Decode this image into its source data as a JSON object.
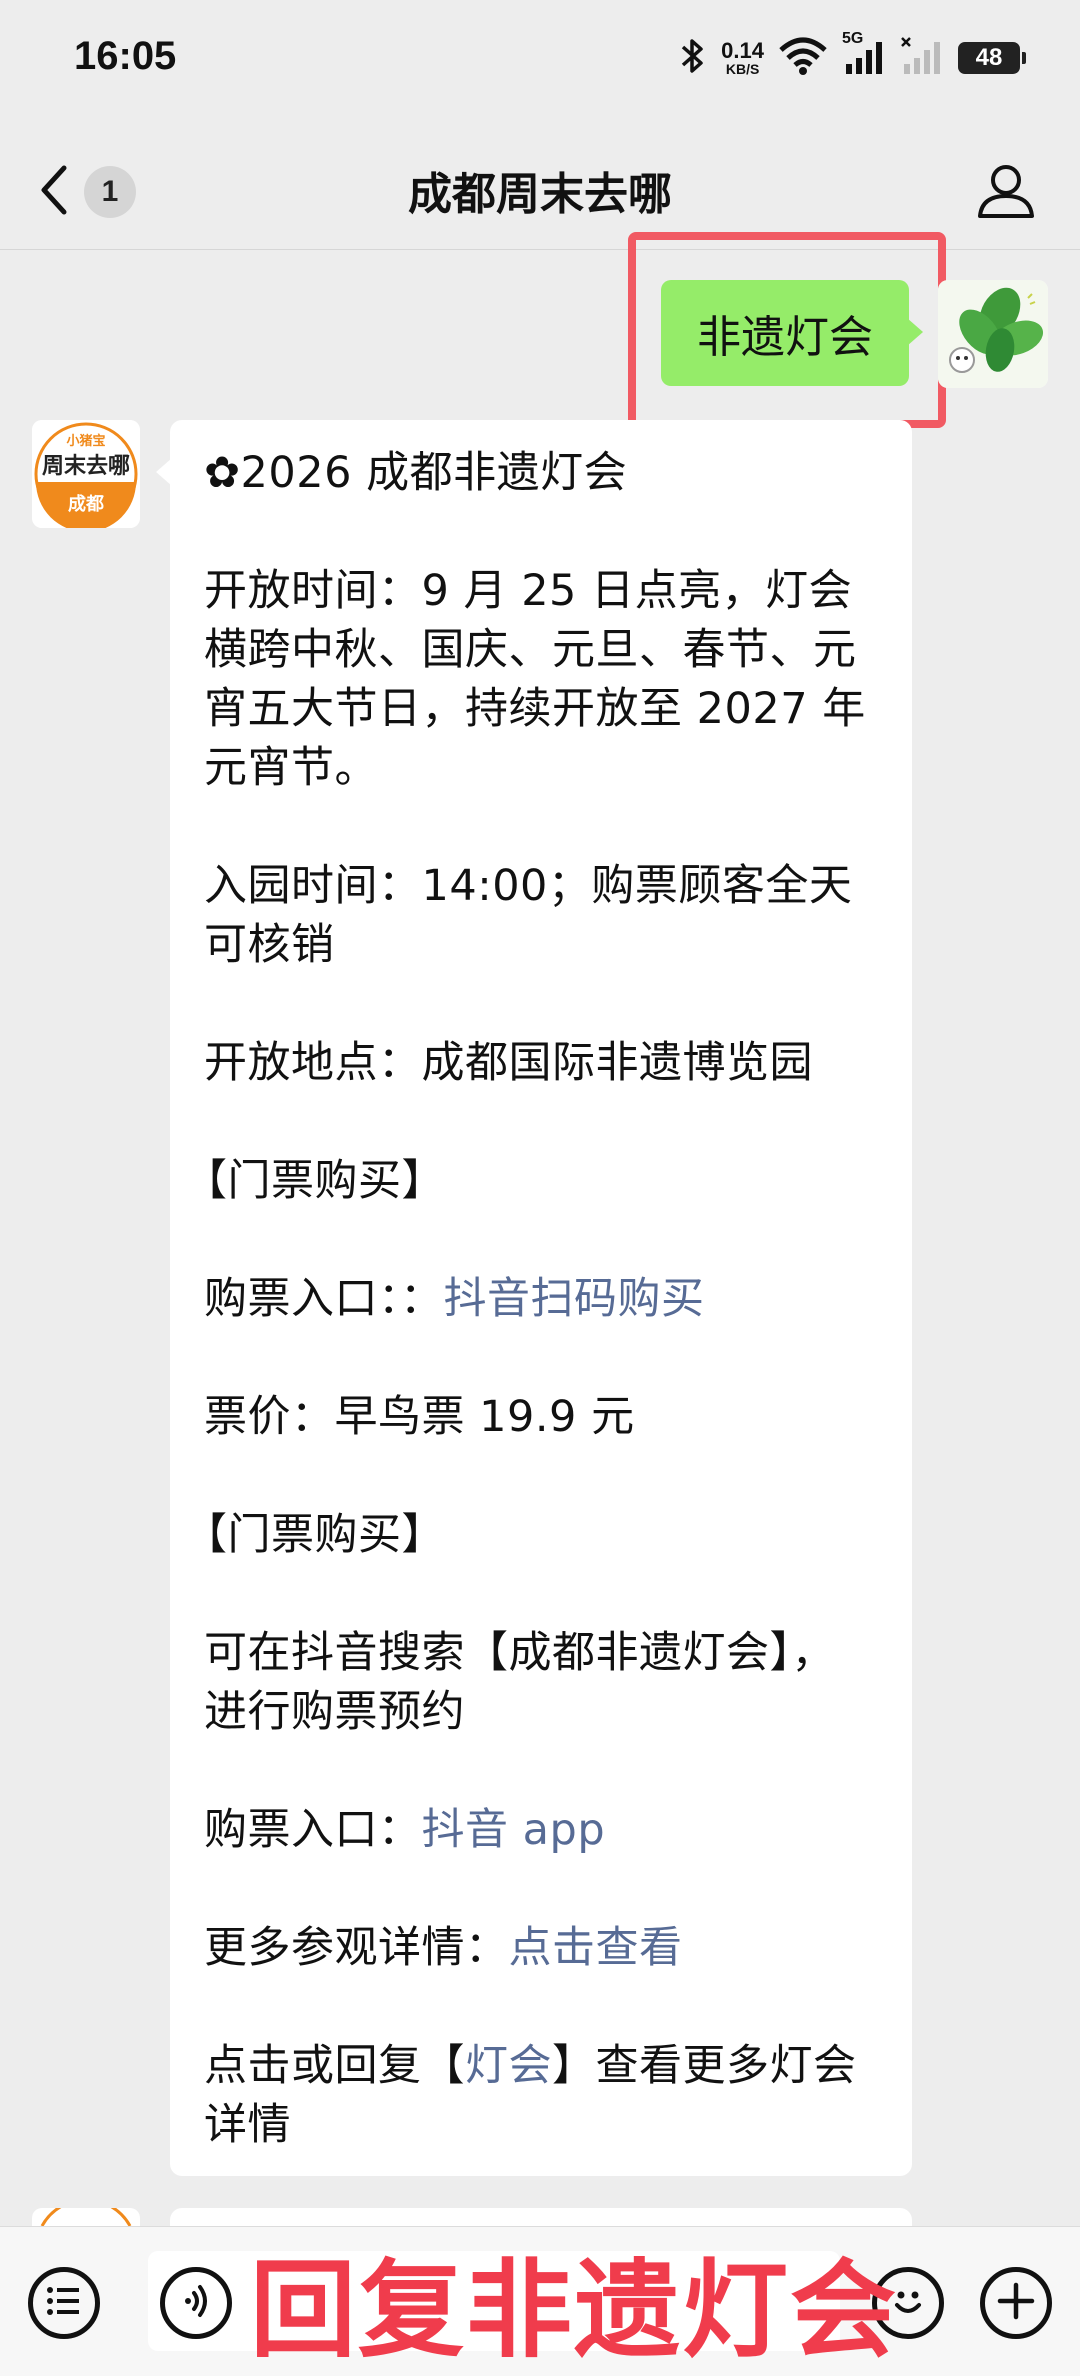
{
  "status_bar": {
    "time": "16:05",
    "net_speed_value": "0.14",
    "net_speed_unit": "KB/S",
    "network_type": "5G",
    "battery": "48"
  },
  "header": {
    "unread_count": "1",
    "title": "成都周末去哪"
  },
  "messages": {
    "outgoing_text": "非遗灯会",
    "bot_avatar_top": "小猪宝",
    "bot_avatar_main": "周末去哪",
    "bot_avatar_sub": "成都",
    "reply": {
      "title": "✿2026 成都非遗灯会",
      "open_time_1": "开放时间：9 月 25 日点亮，灯会",
      "open_time_2": "横跨中秋、国庆、元旦、春节、元",
      "open_time_3": "宵五大节日，持续开放至 2027 年",
      "open_time_4": "元宵节。",
      "entry_time_1": "入园时间：14:00；购票顾客全天",
      "entry_time_2": "可核销",
      "location": "开放地点：成都国际非遗博览园",
      "section_1": "【门票购买】",
      "ticket_entry_label": "购票入口：：",
      "ticket_entry_link": "抖音扫码购买",
      "price": "票价：早鸟票 19.9 元",
      "section_2": "【门票购买】",
      "search_1": "可在抖音搜索【成都非遗灯会】，",
      "search_2": "进行购票预约",
      "app_entry_label": "购票入口：",
      "app_entry_link": "抖音 app",
      "details_label": "更多参观详情：",
      "details_link": "点击查看",
      "reply_prefix": "点击或回复【",
      "reply_link": "灯会",
      "reply_suffix": "】查看更多灯会",
      "reply_line2": "详情"
    }
  },
  "overlay": {
    "caption": "回复非遗灯会"
  },
  "colors": {
    "highlight": "#f15a63",
    "overlay_text": "#f03c4c",
    "bubble_green": "#95ec69",
    "link": "#576b95"
  }
}
